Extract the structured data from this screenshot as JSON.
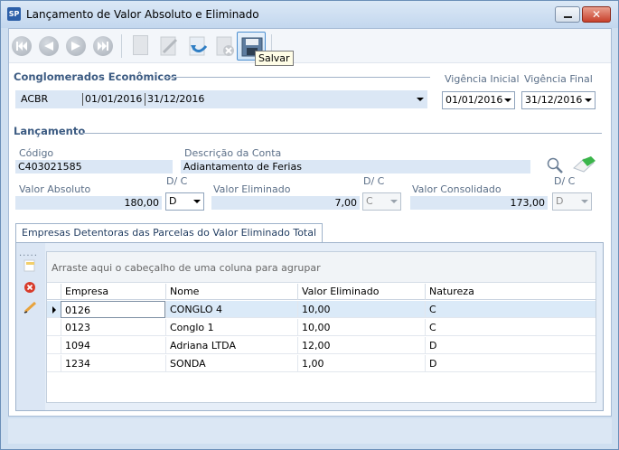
{
  "window": {
    "title": "Lançamento de Valor Absoluto e Eliminado",
    "app_icon_text": "SP"
  },
  "toolbar": {
    "buttons": [
      "first-icon",
      "previous-icon",
      "next-icon",
      "last-icon",
      "new-document-icon",
      "edit-icon",
      "undo-icon",
      "delete-icon",
      "save-icon"
    ],
    "tooltip": "Salvar"
  },
  "conglomerados": {
    "title": "Conglomerados Econômicos",
    "value_name": "ACBR",
    "value_start": "01/01/2016",
    "value_end": "31/12/2016",
    "vigencia_inicial_label": "Vigência Inicial",
    "vigencia_inicial_value": "01/01/2016",
    "vigencia_final_label": "Vigência Final",
    "vigencia_final_value": "31/12/2016"
  },
  "lancamento": {
    "title": "Lançamento",
    "codigo_label": "Código",
    "codigo_value": "C403021585",
    "descricao_label": "Descrição da Conta",
    "descricao_value": "Adiantamento de Ferias",
    "valor_absoluto_label": "Valor Absoluto",
    "valor_absoluto_value": "180,00",
    "dc1_label": "D/ C",
    "dc1_value": "D",
    "valor_eliminado_label": "Valor Eliminado",
    "valor_eliminado_value": "7,00",
    "dc2_label": "D/ C",
    "dc2_value": "C",
    "valor_consolidado_label": "Valor Consolidado",
    "valor_consolidado_value": "173,00",
    "dc3_label": "D/ C",
    "dc3_value": "D"
  },
  "tab": {
    "label": "Empresas Detentoras das Parcelas do Valor Eliminado Total",
    "group_hint": "Arraste aqui o cabeçalho de uma coluna para agrupar",
    "columns": [
      "Empresa",
      "Nome",
      "Valor Eliminado",
      "Natureza"
    ],
    "rows": [
      {
        "empresa": "0126",
        "nome": "CONGLO 4",
        "valor": "10,00",
        "natureza": "C"
      },
      {
        "empresa": "0123",
        "nome": "Conglo 1",
        "valor": "10,00",
        "natureza": "C"
      },
      {
        "empresa": "1094",
        "nome": "Adriana LTDA",
        "valor": "12,00",
        "natureza": "D"
      },
      {
        "empresa": "1234",
        "nome": "SONDA",
        "valor": "1,00",
        "natureza": "D"
      }
    ],
    "dots": "....."
  },
  "colors": {
    "accent": "#3c5b82",
    "field_bg": "#dbe7f5",
    "selected_row": "#dbeaf8"
  }
}
